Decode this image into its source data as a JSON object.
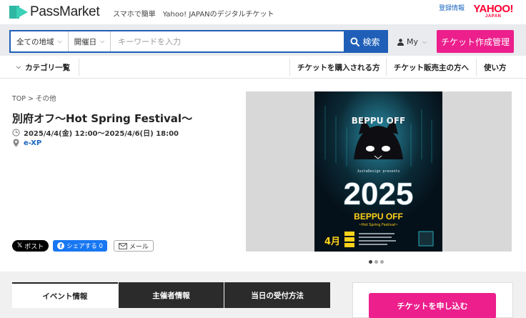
{
  "header": {
    "brand": "PassMarket",
    "tagline": "スマホで簡単　Yahoo! JAPANのデジタルチケット",
    "registration_link": "登録情報",
    "yahoo_logo_lettering": "YAHOO!",
    "yahoo_logo_sub": "JAPAN"
  },
  "search": {
    "region_label": "全ての地域",
    "date_label": "開催日",
    "keyword_placeholder": "キーワードを入力",
    "keyword_value": "",
    "search_label": "検索",
    "my_label": "My",
    "create_ticket_label": "チケット作成管理"
  },
  "nav": {
    "category_label": "カテゴリ一覧",
    "links": [
      "チケットを購入される方",
      "チケット販売主の方へ",
      "使い方"
    ]
  },
  "event": {
    "breadcrumb": "TOP > その他",
    "title": "別府オフ〜Hot Spring Festival〜",
    "datetime": "2025/4/4(金) 12:00〜2025/4/6(日) 18:00",
    "organizer": "e-XP"
  },
  "share": {
    "x_label": "ポスト",
    "facebook_label": "シェアする 0",
    "mail_label": "メール"
  },
  "poster": {
    "logo_text": "BEPPU OFF",
    "presenter": "JustaDesign presents",
    "year": "2025",
    "event_name": "BEPPU OFF",
    "subtitle": "~Hot Spring Festival~",
    "month": "4月"
  },
  "gallery": {
    "slide_count": 3,
    "active_slide": 1
  },
  "tabs": [
    {
      "label": "イベント情報",
      "active": true
    },
    {
      "label": "主催者情報",
      "active": false
    },
    {
      "label": "当日の受付方法",
      "active": false
    }
  ],
  "apply_label": "チケットを申し込む",
  "colors": {
    "primary_blue": "#1f5fb8",
    "accent_pink": "#ec1f8c",
    "brand_teal": "#2fb7a3",
    "link_blue": "#1a67c0"
  }
}
